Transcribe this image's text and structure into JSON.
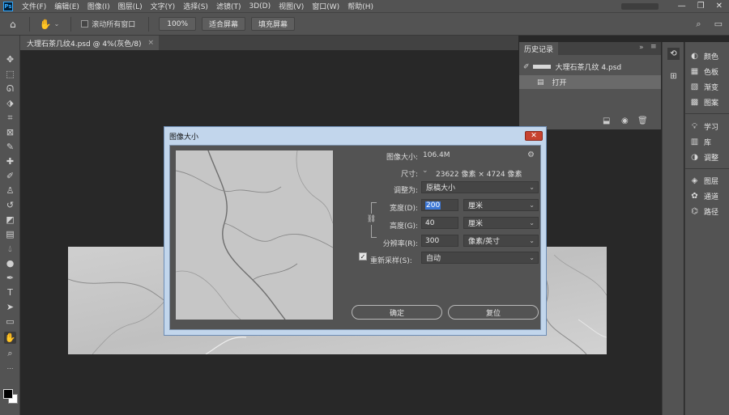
{
  "app": {
    "logo": "Ps"
  },
  "menu": [
    "文件(F)",
    "编辑(E)",
    "图像(I)",
    "图层(L)",
    "文字(Y)",
    "选择(S)",
    "滤镜(T)",
    "3D(D)",
    "视图(V)",
    "窗口(W)",
    "帮助(H)"
  ],
  "window_controls": {
    "minimize": "—",
    "restore": "❐",
    "close": "✕"
  },
  "options_bar": {
    "scroll_all_label": "滚动所有窗口",
    "zoom_value": "100%",
    "fit_screen_label": "适合屏幕",
    "fill_screen_label": "填充屏幕"
  },
  "document_tab": {
    "title": "大理石茶几纹4.psd @ 4%(灰色/8)",
    "close": "×"
  },
  "history_panel": {
    "title": "历史记录",
    "snapshot_name": "大理石茶几纹 4.psd",
    "steps": [
      "打开"
    ]
  },
  "right_dock": {
    "group1": [
      "颜色",
      "色板",
      "渐变",
      "图案"
    ],
    "group2": [
      "学习",
      "库",
      "调整"
    ],
    "group3": [
      "图层",
      "通道",
      "路径"
    ]
  },
  "dialog": {
    "title": "图像大小",
    "close": "✕",
    "image_size_label": "图像大小:",
    "image_size_value": "106.4M",
    "dimensions_label": "尺寸:",
    "dimensions_value": "23622 像素  ×  4724 像素",
    "fit_to_label": "调整为:",
    "fit_to_value": "原稿大小",
    "width_label": "宽度(D):",
    "width_value": "200",
    "width_unit": "厘米",
    "height_label": "高度(G):",
    "height_value": "40",
    "height_unit": "厘米",
    "resolution_label": "分辨率(R):",
    "resolution_value": "300",
    "resolution_unit": "像素/英寸",
    "resample_label": "重新采样(S):",
    "resample_value": "自动",
    "resample_checked": true,
    "ok_label": "确定",
    "reset_label": "复位"
  }
}
